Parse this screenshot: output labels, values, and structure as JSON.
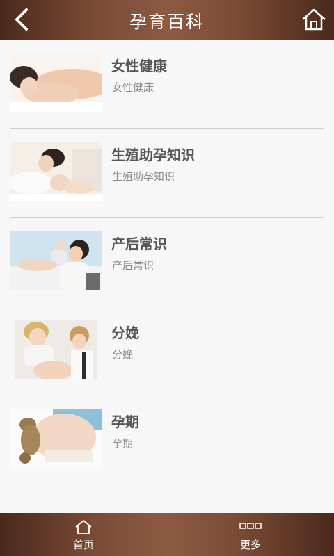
{
  "header": {
    "title": "孕育百科"
  },
  "items": [
    {
      "title": "女性健康",
      "subtitle": "女性健康",
      "image": "woman-relaxing-photo"
    },
    {
      "title": "生殖助孕知识",
      "subtitle": "生殖助孕知识",
      "image": "mother-and-baby-photo"
    },
    {
      "title": "产后常识",
      "subtitle": "产后常识",
      "image": "mother-lifting-baby-photo"
    },
    {
      "title": "分娩",
      "subtitle": "分娩",
      "image": "pregnant-woman-with-doctor-photo"
    },
    {
      "title": "孕期",
      "subtitle": "孕期",
      "image": "pregnant-belly-teddy-bear-photo"
    }
  ],
  "footer": {
    "tabs": [
      {
        "label": "首页",
        "icon": "home-icon"
      },
      {
        "label": "更多",
        "icon": "more-icon"
      }
    ]
  },
  "colors": {
    "bar": "#7a4a35",
    "background": "#f7f7f7",
    "title_text": "#555555",
    "subtitle_text": "#888888"
  }
}
